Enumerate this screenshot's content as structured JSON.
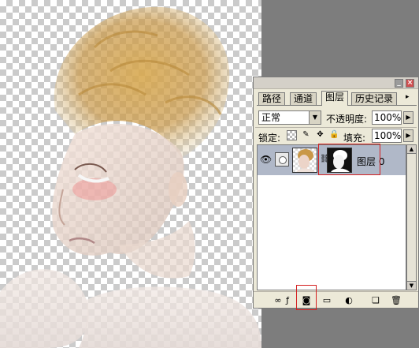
{
  "canvas": {
    "description_icon": "portrait-layer"
  },
  "layers_panel": {
    "window_buttons": {
      "minimize": "_",
      "close": "×"
    },
    "tabs": [
      {
        "label": "路径",
        "active": false
      },
      {
        "label": "通道",
        "active": false
      },
      {
        "label": "图层",
        "active": true
      },
      {
        "label": "历史记录",
        "active": false
      }
    ],
    "tab_menu_icon": "▸",
    "blend_mode": "正常",
    "opacity_label": "不透明度:",
    "opacity_value": "100%",
    "lock_label": "锁定:",
    "fill_label": "填充:",
    "fill_value": "100%",
    "layers": [
      {
        "name": "图层 0",
        "visible": true,
        "selected": true,
        "has_mask": true
      }
    ],
    "bottom_toolbar": [
      "link-layers",
      "layer-style",
      "add-layer-mask",
      "new-group",
      "adjustment-layer",
      "new-layer",
      "delete-layer"
    ],
    "highlight_color": "#d42020"
  }
}
